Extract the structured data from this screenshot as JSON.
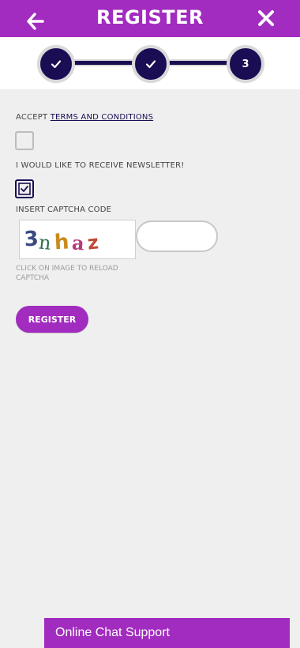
{
  "header": {
    "title": "REGISTER",
    "back_icon": "back-arrow-icon",
    "close_icon": "close-icon",
    "background_color": "#a12cbf"
  },
  "stepper": {
    "steps": [
      {
        "state": "completed",
        "icon": "check-icon"
      },
      {
        "state": "completed",
        "icon": "check-icon"
      },
      {
        "state": "current",
        "label": "3"
      }
    ],
    "color": "#1b0d53"
  },
  "form": {
    "accept_prefix": "ACCEPT",
    "terms_link": "TERMS AND CONDITIONS",
    "accept_checked": false,
    "newsletter_label": "I WOULD LIKE TO RECEIVE NEWSLETTER!",
    "newsletter_checked": true,
    "captcha_label": "INSERT CAPTCHA CODE",
    "captcha_text": "3nhaz",
    "captcha_value": "",
    "captcha_hint": "CLICK ON IMAGE TO RELOAD CAPTCHA",
    "register_label": "REGISTER"
  },
  "chat": {
    "label": "Online Chat Support"
  }
}
